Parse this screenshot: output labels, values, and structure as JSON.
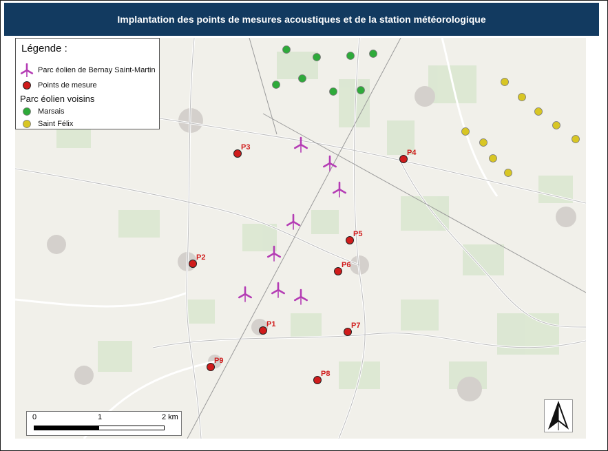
{
  "title": "Implantation des points de mesures acoustiques et de la station météorologique",
  "legend": {
    "heading": "Légende :",
    "wind_farm_label": "Parc éolien de Bernay Saint-Martin",
    "measure_points_label": "Points de mesure",
    "neighbor_heading": "Parc éolien voisins",
    "neighbor_1": "Marsais",
    "neighbor_2": "Saint Félix"
  },
  "colors": {
    "header_bg": "#123a60",
    "turbine": "#b43cb4",
    "measure_point": "#d01c1c",
    "marsais": "#2eaa3a",
    "saint_felix": "#d8c624"
  },
  "scale": {
    "label_0": "0",
    "label_1": "1",
    "label_2": "2 km"
  },
  "measure_points": [
    "P1",
    "P2",
    "P3",
    "P4",
    "P5",
    "P6",
    "P7",
    "P8",
    "P9"
  ],
  "north_arrow": "north-arrow-icon"
}
